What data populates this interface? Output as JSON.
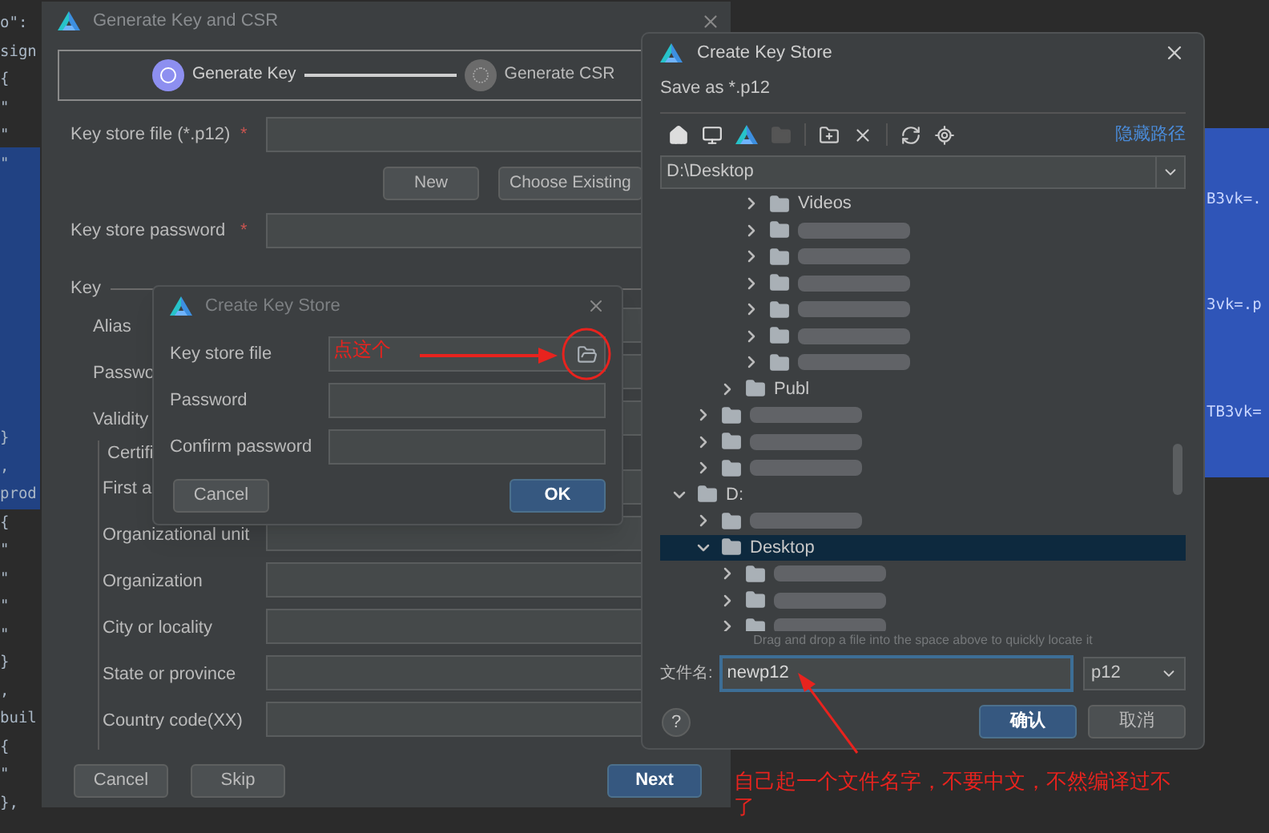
{
  "editor": {
    "code_top": [
      "o\":",
      "sign",
      "{",
      "\"",
      "\"",
      "\""
    ],
    "code_bottom": [
      "}",
      ",",
      "prod",
      "{",
      "\"",
      "\"",
      "\"",
      "\"",
      "}",
      ",",
      "buil",
      "{",
      "\"",
      "},"
    ],
    "code_right": [
      "B3vk=.",
      "3vk=.p",
      "TB3vk="
    ]
  },
  "main_dialog": {
    "title": "Generate Key and CSR",
    "steps": [
      {
        "label": "Generate Key",
        "selected": true
      },
      {
        "label": "Generate CSR",
        "selected": false
      }
    ],
    "keystore_file": {
      "label": "Key store file (*.p12)",
      "marker": "*"
    },
    "file_buttons": [
      "New",
      "Choose Existing"
    ],
    "keystore_password": {
      "label": "Key store password",
      "marker": "*"
    },
    "key_section": {
      "title": "Key",
      "fields": [
        "Alias",
        "Passwo",
        "Validity"
      ],
      "certificate": {
        "title": "Certifi",
        "fields": [
          "First a",
          "Organizational unit",
          "Organization",
          "City or locality",
          "State or province",
          "Country code(XX)"
        ]
      }
    },
    "buttons": [
      {
        "label": "Cancel",
        "primary": false
      },
      {
        "label": "Skip",
        "primary": false
      },
      {
        "label": "Next",
        "primary": true
      }
    ]
  },
  "small_dialog": {
    "title": "Create Key Store",
    "fields": [
      {
        "label": "Key store file",
        "kind": "file"
      },
      {
        "label": "Password",
        "kind": "text"
      },
      {
        "label": "Confirm password",
        "kind": "text"
      }
    ],
    "buttons": [
      {
        "label": "Cancel",
        "primary": false
      },
      {
        "label": "OK",
        "primary": true
      }
    ]
  },
  "file_dialog": {
    "title": "Create Key Store",
    "subtitle": "Save as *.p12",
    "hide_path_link": "隐藏路径",
    "path": "D:\\Desktop",
    "tree": [
      {
        "children": [
          {
            "children": [
              {
                "children": [
                  {
                    "label": "Videos",
                    "blurred": false,
                    "expanded": false,
                    "selected": false
                  },
                  {
                    "blurred": true,
                    "expanded": false,
                    "selected": false
                  },
                  {
                    "blurred": true,
                    "expanded": false,
                    "selected": false
                  },
                  {
                    "blurred": true,
                    "expanded": false,
                    "selected": false
                  },
                  {
                    "blurred": true,
                    "expanded": false,
                    "selected": false
                  },
                  {
                    "blurred": true,
                    "expanded": false,
                    "selected": false
                  },
                  {
                    "blurred": true,
                    "expanded": false,
                    "selected": false
                  }
                ]
              },
              {
                "label": "Publ",
                "blurred": false,
                "expanded": false,
                "selected": false
              }
            ]
          },
          {
            "blurred": true,
            "expanded": false,
            "selected": false
          },
          {
            "blurred": true,
            "expanded": false,
            "selected": false
          },
          {
            "blurred": true,
            "expanded": false,
            "selected": false
          }
        ]
      },
      {
        "label": "D:",
        "blurred": false,
        "expanded": true,
        "selected": false,
        "children": [
          {
            "blurred": true,
            "expanded": false,
            "selected": false
          },
          {
            "label": "Desktop",
            "blurred": false,
            "expanded": true,
            "selected": true,
            "children": [
              {
                "blurred": true,
                "expanded": false,
                "selected": false
              },
              {
                "blurred": true,
                "expanded": false,
                "selected": false
              },
              {
                "blurred": true,
                "expanded": false,
                "selected": false
              }
            ]
          }
        ]
      }
    ],
    "hint": "Drag and drop a file into the space above to quickly locate it",
    "filename_label": "文件名:",
    "filename": "newp12",
    "filetype": "p12",
    "help": "?",
    "buttons": [
      {
        "label": "确认",
        "primary": true
      },
      {
        "label": "取消",
        "primary": false
      }
    ]
  },
  "annotations": {
    "click_here": "点这个",
    "filename_note": "自己起一个文件名字，不要中文，不然编译过不了"
  }
}
